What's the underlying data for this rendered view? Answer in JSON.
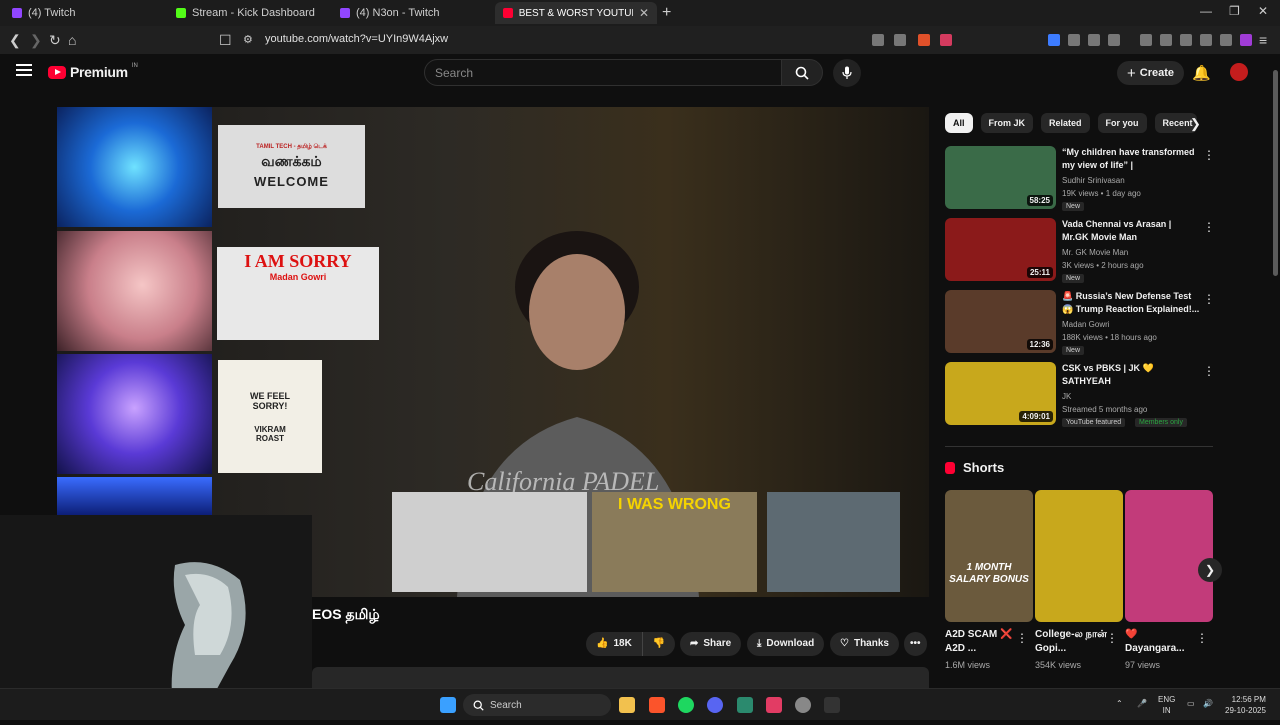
{
  "browser": {
    "tabs": [
      {
        "label": "(4) Twitch",
        "color": "#9146ff"
      },
      {
        "label": "Stream - Kick Dashboard",
        "color": "#53fc18"
      },
      {
        "label": "(4) N3on - Twitch",
        "color": "#9146ff"
      },
      {
        "label": "BEST & WORST YOUTUBER APO",
        "color": "#ff0033"
      }
    ],
    "url": "youtube.com/watch?v=UYIn9W4Ajxw"
  },
  "youtube": {
    "logo_text": "Premium",
    "logo_sup": "IN",
    "search_placeholder": "Search",
    "create_label": "Create"
  },
  "video": {
    "title_tail": "EOS தமிழ்",
    "overlay_texts": {
      "welcome_top": "TAMIL TECH - தமிழ் டெக்",
      "welcome_tamil": "வணக்கம்",
      "welcome_en": "WELCOME",
      "sorry": "I AM SORRY",
      "sorry_name": "Madan Gowri",
      "feel_sorry": "WE FEEL SORRY!",
      "vikram": "VIKRAM ROAST",
      "wrong": "I WAS WRONG",
      "shirt": "California PADEL"
    },
    "actions": {
      "likes": "18K",
      "share": "Share",
      "download": "Download",
      "thanks": "Thanks"
    }
  },
  "chips": [
    "All",
    "From JK",
    "Related",
    "For you",
    "Recent"
  ],
  "recommendations": [
    {
      "title": "“My children have transformed my view of life” | Selvaraghava...",
      "channel": "Sudhir Srinivasan",
      "meta": "19K views • 1 day ago",
      "badge": "New",
      "duration": "58:25",
      "thumb_color": "#3a6b48"
    },
    {
      "title": "Vada Chennai vs Arasan | Mr.GK Movie Man",
      "channel": "Mr. GK Movie Man",
      "meta": "3K views • 2 hours ago",
      "badge": "New",
      "duration": "25:11",
      "thumb_color": "#8b1a1a"
    },
    {
      "title": "🚨 Russia’s New Defense Test 😱 Trump Reaction Explained!...",
      "channel": "Madan Gowri",
      "meta": "188K views • 18 hours ago",
      "badge": "New",
      "duration": "12:36",
      "thumb_color": "#5a3b2a"
    },
    {
      "title": "CSK vs PBKS | JK 💛 SATHYEAH",
      "channel": "JK",
      "meta": "Streamed 5 months ago",
      "badge": "YouTube featured",
      "badge2": "Members only",
      "duration": "4:09:01",
      "thumb_color": "#c8a81c"
    }
  ],
  "shorts": {
    "heading": "Shorts",
    "items": [
      {
        "title": "A2D SCAM ❌ A2D ...",
        "views": "1.6M views",
        "caption": "1 MONTH SALARY BONUS",
        "color": "#6b5a3d"
      },
      {
        "title": "College-ல நான் Gopi...",
        "views": "354K views",
        "caption": "",
        "color": "#c8a81c"
      },
      {
        "title": "❤️ Dayangara...",
        "views": "97 views",
        "caption": "",
        "color": "#c23b7a"
      }
    ]
  },
  "taskbar": {
    "search": "Search",
    "lang_top": "ENG",
    "lang_bottom": "IN",
    "time": "12:56 PM",
    "date": "29-10-2025"
  }
}
